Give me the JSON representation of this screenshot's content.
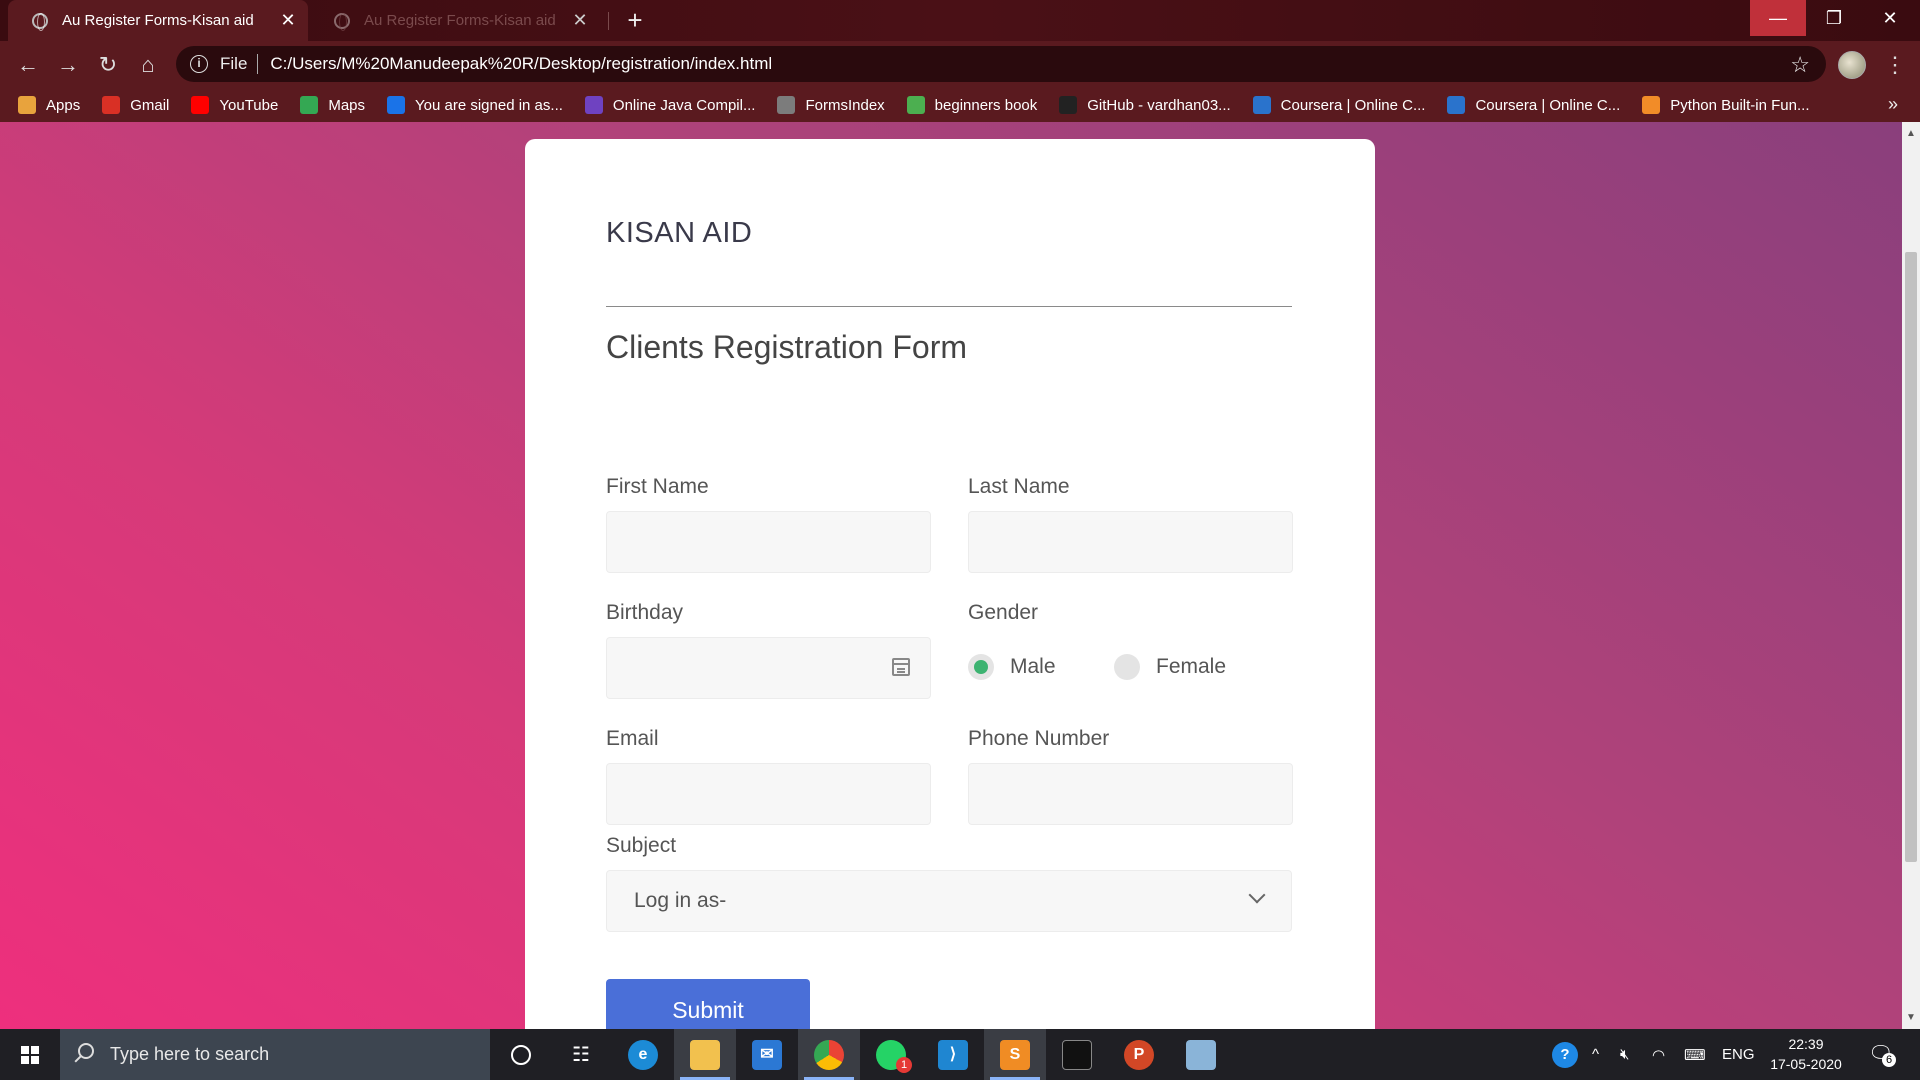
{
  "browser": {
    "tabs": [
      {
        "title": "Au Register Forms-Kisan aid",
        "active": true
      },
      {
        "title": "Au Register Forms-Kisan aid",
        "active": false
      }
    ],
    "address": {
      "scheme": "File",
      "url": "C:/Users/M%20Manudeepak%20R/Desktop/registration/index.html"
    },
    "bookmarks": [
      {
        "label": "Apps",
        "icon": "apps-grid-icon",
        "color": "#e8a33d"
      },
      {
        "label": "Gmail",
        "icon": "gmail-icon",
        "color": "#d93025"
      },
      {
        "label": "YouTube",
        "icon": "youtube-icon",
        "color": "#ff0000"
      },
      {
        "label": "Maps",
        "icon": "maps-icon",
        "color": "#34a853"
      },
      {
        "label": "You are signed in as...",
        "icon": "s-icon",
        "color": "#1a73e8"
      },
      {
        "label": "Online Java Compil...",
        "icon": "bolt-icon",
        "color": "#6f42c1"
      },
      {
        "label": "FormsIndex",
        "icon": "formsindex-icon",
        "color": "#7c7c7c"
      },
      {
        "label": "beginners book",
        "icon": "bb-icon",
        "color": "#4caf50"
      },
      {
        "label": "GitHub - vardhan03...",
        "icon": "github-icon",
        "color": "#222222"
      },
      {
        "label": "Coursera | Online C...",
        "icon": "coursera-icon",
        "color": "#2a73cc"
      },
      {
        "label": "Coursera | Online C...",
        "icon": "coursera-icon",
        "color": "#2a73cc"
      },
      {
        "label": "Python Built-in Fun...",
        "icon": "cone-icon",
        "color": "#f28c28"
      }
    ],
    "more_bookmarks": "»"
  },
  "form": {
    "brand": "KISAN AID",
    "title": "Clients Registration Form",
    "first_name_label": "First Name",
    "last_name_label": "Last Name",
    "birthday_label": "Birthday",
    "gender_label": "Gender",
    "gender_options": [
      "Male",
      "Female"
    ],
    "gender_selected": "Male",
    "email_label": "Email",
    "phone_label": "Phone Number",
    "subject_label": "Subject",
    "subject_value": "Log in as-",
    "submit_label": "Submit",
    "accent": "#4a6fd8",
    "radio_color": "#3cb371"
  },
  "taskbar": {
    "search_placeholder": "Type here to search",
    "lang": "ENG",
    "time": "22:39",
    "date": "17-05-2020",
    "notification_count": "6",
    "whatsapp_badge": "1"
  }
}
